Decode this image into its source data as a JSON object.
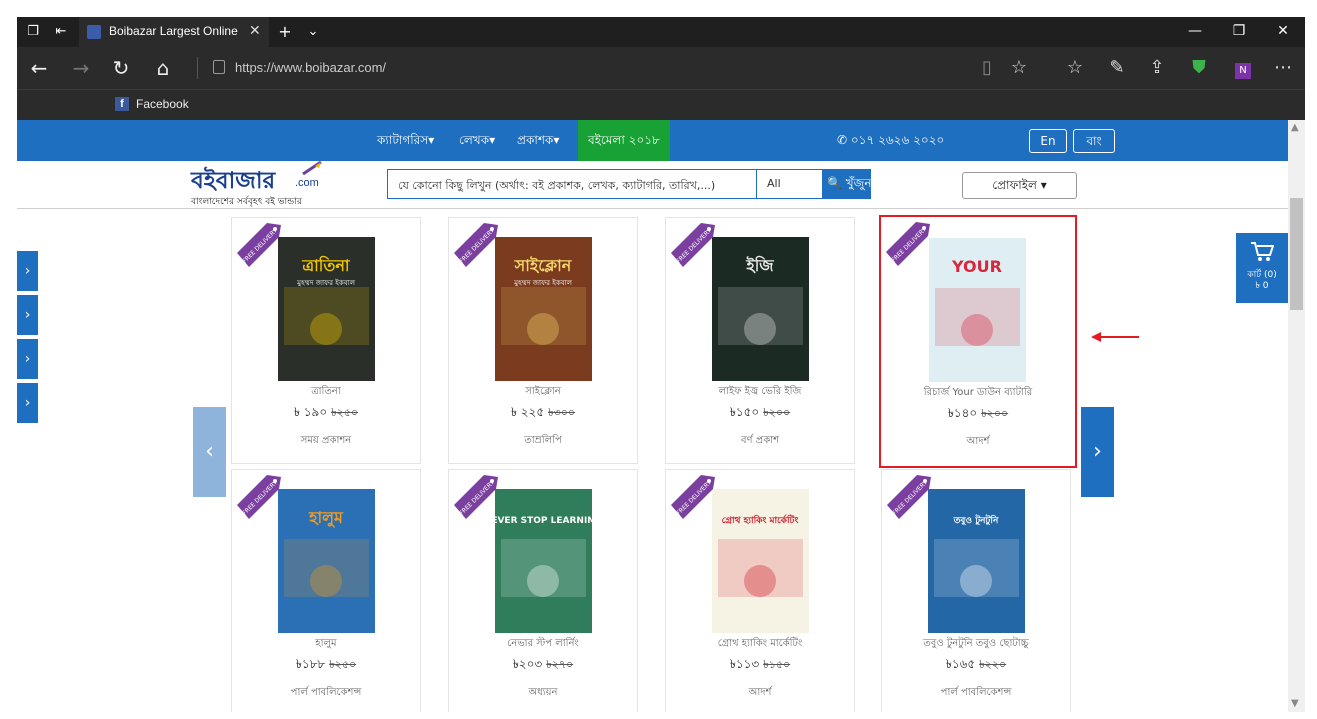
{
  "browser": {
    "tab_title": "Boibazar Largest Online",
    "tab_close": "✕",
    "new_tab": "+",
    "tab_menu": "⌄",
    "url": "https://www.boibazar.com/",
    "favorites": [
      {
        "label": "Facebook",
        "icon": "f"
      }
    ]
  },
  "nav": {
    "items": [
      {
        "label": "ক্যাটাগরিস▾"
      },
      {
        "label": "লেখক▾"
      },
      {
        "label": "প্রকাশক▾"
      },
      {
        "label": "বইমেলা ২০১৮"
      }
    ],
    "phone": "✆ ০১৭ ২৬২৬ ২০২০",
    "lang_en": "En",
    "lang_bn": "বাং"
  },
  "header": {
    "logo": "বইবাজার",
    "logo_com": ".com",
    "tagline": "বাংলাদেশের সর্ববৃহৎ বই ভান্ডার",
    "search_placeholder": "যে কোনো কিছু লিখুন (অর্থাৎ: বই প্রকাশক, লেখক, ক্যাটাগরি, তারিখ,...)",
    "search_select": "All",
    "search_button": "🔍 খুঁজুন",
    "profile": "প্রোফাইল ▾"
  },
  "carousel": {
    "prev": "‹",
    "next": "›"
  },
  "side_arrows": [
    "›",
    "›",
    "›",
    "›"
  ],
  "cart": {
    "label": "কার্ট (0)",
    "total": "৳ 0"
  },
  "badge": "FREE DELIVERY",
  "books": [
    {
      "title": "ত্রাতিনা",
      "price": "৳ ১৯০",
      "old_price": "৳২৫০",
      "publisher": "সময় প্রকাশন",
      "cover_title": "ত্রাতিনা",
      "cover_author": "মুহম্মদ জাফর ইকবাল",
      "cover_bg": "#2a2f2a",
      "cover_accent": "#f2c500",
      "highlight": false
    },
    {
      "title": "সাইক্লোন",
      "price": "৳ ২২৫",
      "old_price": "৳৩০০",
      "publisher": "তাম্রলিপি",
      "cover_title": "সাইক্লোন",
      "cover_author": "মুহম্মদ জাফর ইকবাল",
      "cover_bg": "#7a3b1e",
      "cover_accent": "#f6d46a",
      "highlight": false
    },
    {
      "title": "লাইফ ইজ্ব ভেরি ইজি",
      "price": "৳১৫০",
      "old_price": "৳২০০",
      "publisher": "বর্ণ প্রকাশ",
      "cover_title": "ইজি",
      "cover_author": "",
      "cover_bg": "#1c2a24",
      "cover_accent": "#e9e9e9",
      "highlight": false
    },
    {
      "title": "রিচার্জ Your ডাউন ব্যাটারি",
      "price": "৳১৪০",
      "old_price": "৳২০০",
      "publisher": "আদর্শ",
      "cover_title": "YOUR",
      "cover_author": "",
      "cover_bg": "#dfeef2",
      "cover_accent": "#d7263d",
      "highlight": true
    },
    {
      "title": "হালুম",
      "price": "৳১৮৮",
      "old_price": "৳২৫০",
      "publisher": "পার্ল পাবলিকেশন্স",
      "cover_title": "হালুম",
      "cover_author": "",
      "cover_bg": "#2b6fb5",
      "cover_accent": "#f09a1e",
      "highlight": false
    },
    {
      "title": "নেভার স্টপ লার্নিং",
      "price": "৳২০৩",
      "old_price": "৳২৭০",
      "publisher": "অধ্যয়ন",
      "cover_title": "NEVER STOP LEARNING",
      "cover_author": "",
      "cover_bg": "#2f7d5b",
      "cover_accent": "#ffffff",
      "highlight": false
    },
    {
      "title": "গ্রোথ হ্যাকিং মার্কেটিং",
      "price": "৳১১৩",
      "old_price": "৳১৫০",
      "publisher": "আদর্শ",
      "cover_title": "গ্রোথ হ্যাকিং মার্কেটিং",
      "cover_author": "",
      "cover_bg": "#f6f2e4",
      "cover_accent": "#d01c2a",
      "highlight": false
    },
    {
      "title": "তবুও টুনটুনি তবুও ছোটাচ্চু",
      "price": "৳১৬৫",
      "old_price": "৳২২০",
      "publisher": "পার্ল পাবলিকেশন্স",
      "cover_title": "তবুও টুনটুনি",
      "cover_author": "",
      "cover_bg": "#2467a6",
      "cover_accent": "#ffffff",
      "highlight": false
    }
  ]
}
